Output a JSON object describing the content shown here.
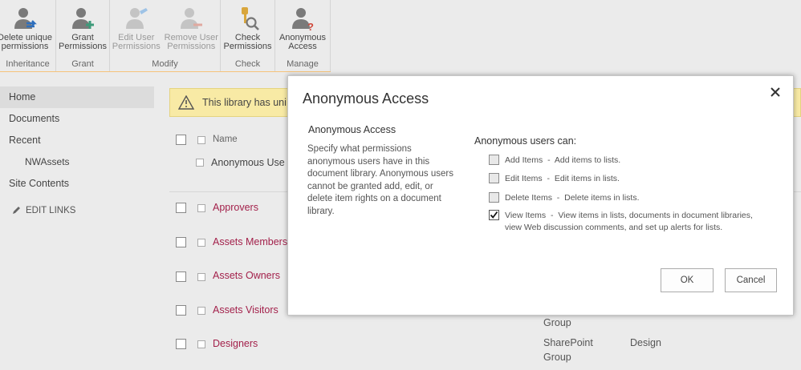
{
  "ribbon": {
    "groups": [
      {
        "label": "Inheritance",
        "buttons": [
          {
            "line1": "Delete unique",
            "line2": "permissions",
            "icon": "user-arrow-icon",
            "enabled": true
          }
        ]
      },
      {
        "label": "Grant",
        "buttons": [
          {
            "line1": "Grant",
            "line2": "Permissions",
            "icon": "user-add-icon",
            "enabled": true
          }
        ]
      },
      {
        "label": "Modify",
        "buttons": [
          {
            "line1": "Edit User",
            "line2": "Permissions",
            "icon": "user-edit-icon",
            "enabled": false
          },
          {
            "line1": "Remove User",
            "line2": "Permissions",
            "icon": "user-remove-icon",
            "enabled": false
          }
        ]
      },
      {
        "label": "Check",
        "buttons": [
          {
            "line1": "Check",
            "line2": "Permissions",
            "icon": "key-magnifier-icon",
            "enabled": true
          }
        ]
      },
      {
        "label": "Manage",
        "buttons": [
          {
            "line1": "Anonymous",
            "line2": "Access",
            "icon": "user-question-icon",
            "enabled": true
          }
        ]
      }
    ]
  },
  "leftnav": {
    "items": [
      "Home",
      "Documents",
      "Recent",
      "NWAssets",
      "Site Contents"
    ],
    "edit_links": "EDIT LINKS"
  },
  "page": {
    "banner": "This library has uni",
    "column_name": "Name",
    "anonymous_row": "Anonymous Use",
    "groups": [
      "Approvers",
      "Assets Members",
      "Assets Owners",
      "Assets Visitors",
      "Designers"
    ],
    "bg_group1": "Group",
    "bg_sharepoint": "SharePoint",
    "bg_group2": "Group",
    "bg_design": "Design"
  },
  "dialog": {
    "title": "Anonymous Access",
    "section_title": "Anonymous Access",
    "section_desc": "Specify what permissions anonymous users have in this document library. Anonymous users cannot be granted add, edit, or delete item rights on a document library.",
    "can_label": "Anonymous users can:",
    "permissions": [
      {
        "name": "Add Items",
        "desc": "Add items to lists.",
        "checked": false
      },
      {
        "name": "Edit Items",
        "desc": "Edit items in lists.",
        "checked": false
      },
      {
        "name": "Delete Items",
        "desc": "Delete items in lists.",
        "checked": false
      },
      {
        "name": "View Items",
        "desc": "View items in lists, documents in document libraries, view Web discussion comments, and set up alerts for lists.",
        "checked": true
      }
    ],
    "separator": "  -  ",
    "ok": "OK",
    "cancel": "Cancel"
  },
  "colors": {
    "link": "#a3214b",
    "banner": "#f8eaa5",
    "ribbon_accent": "#f6c37a"
  }
}
